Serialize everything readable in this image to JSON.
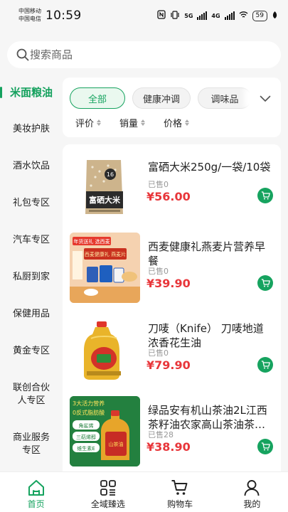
{
  "status_bar": {
    "carrier_1": "中国移动",
    "carrier_2": "中国电信",
    "time": "10:59",
    "network_1": "5G",
    "network_2": "4G",
    "battery": "59"
  },
  "search": {
    "placeholder": "搜索商品"
  },
  "sidebar": {
    "items": [
      {
        "label": "米面粮油",
        "active": true
      },
      {
        "label": "美妆护肤"
      },
      {
        "label": "酒水饮品"
      },
      {
        "label": "礼包专区"
      },
      {
        "label": "汽车专区"
      },
      {
        "label": "私厨到家"
      },
      {
        "label": "保健用品"
      },
      {
        "label": "黄金专区"
      },
      {
        "label": "联创合伙人专区"
      },
      {
        "label": "商业服务专区"
      }
    ]
  },
  "filters": {
    "tabs": [
      {
        "label": "全部",
        "active": true
      },
      {
        "label": "健康冲调"
      },
      {
        "label": "调味品"
      }
    ],
    "sort": [
      {
        "label": "评价"
      },
      {
        "label": "销量"
      },
      {
        "label": "价格"
      }
    ]
  },
  "products": [
    {
      "title": "富硒大米250g/一袋/10袋",
      "sold": "已售0",
      "price": "¥56.00",
      "image": "rice-bag"
    },
    {
      "title": "西麦健康礼燕麦片营养早餐",
      "sold": "已售0",
      "price": "¥39.90",
      "image": "oat-gift-box",
      "image_text": [
        "年货送礼 选西麦",
        "西麦健康礼 燕麦片"
      ]
    },
    {
      "title": "刀唛（Knife） 刀唛地道浓香花生油",
      "sold": "已售0",
      "price": "¥79.90",
      "image": "peanut-oil-bottle"
    },
    {
      "title": "绿品安有机山茶油2L江西茶籽油农家高山茶油茶…",
      "sold": "已售28",
      "price": "¥38.90",
      "image": "camellia-oil",
      "image_text": [
        "3大活力营养",
        "0反式脂肪酸",
        "角鲨烯",
        "三萜烯醇",
        "维生素E",
        "山茶油"
      ]
    }
  ],
  "bottom_nav": [
    {
      "label": "首页",
      "icon": "home-icon",
      "active": true
    },
    {
      "label": "全域臻选",
      "icon": "grid-icon"
    },
    {
      "label": "购物车",
      "icon": "cart-icon"
    },
    {
      "label": "我的",
      "icon": "user-icon"
    }
  ],
  "colors": {
    "brand": "#16a35f",
    "price": "#e8363a",
    "background": "#f6f6f6"
  }
}
